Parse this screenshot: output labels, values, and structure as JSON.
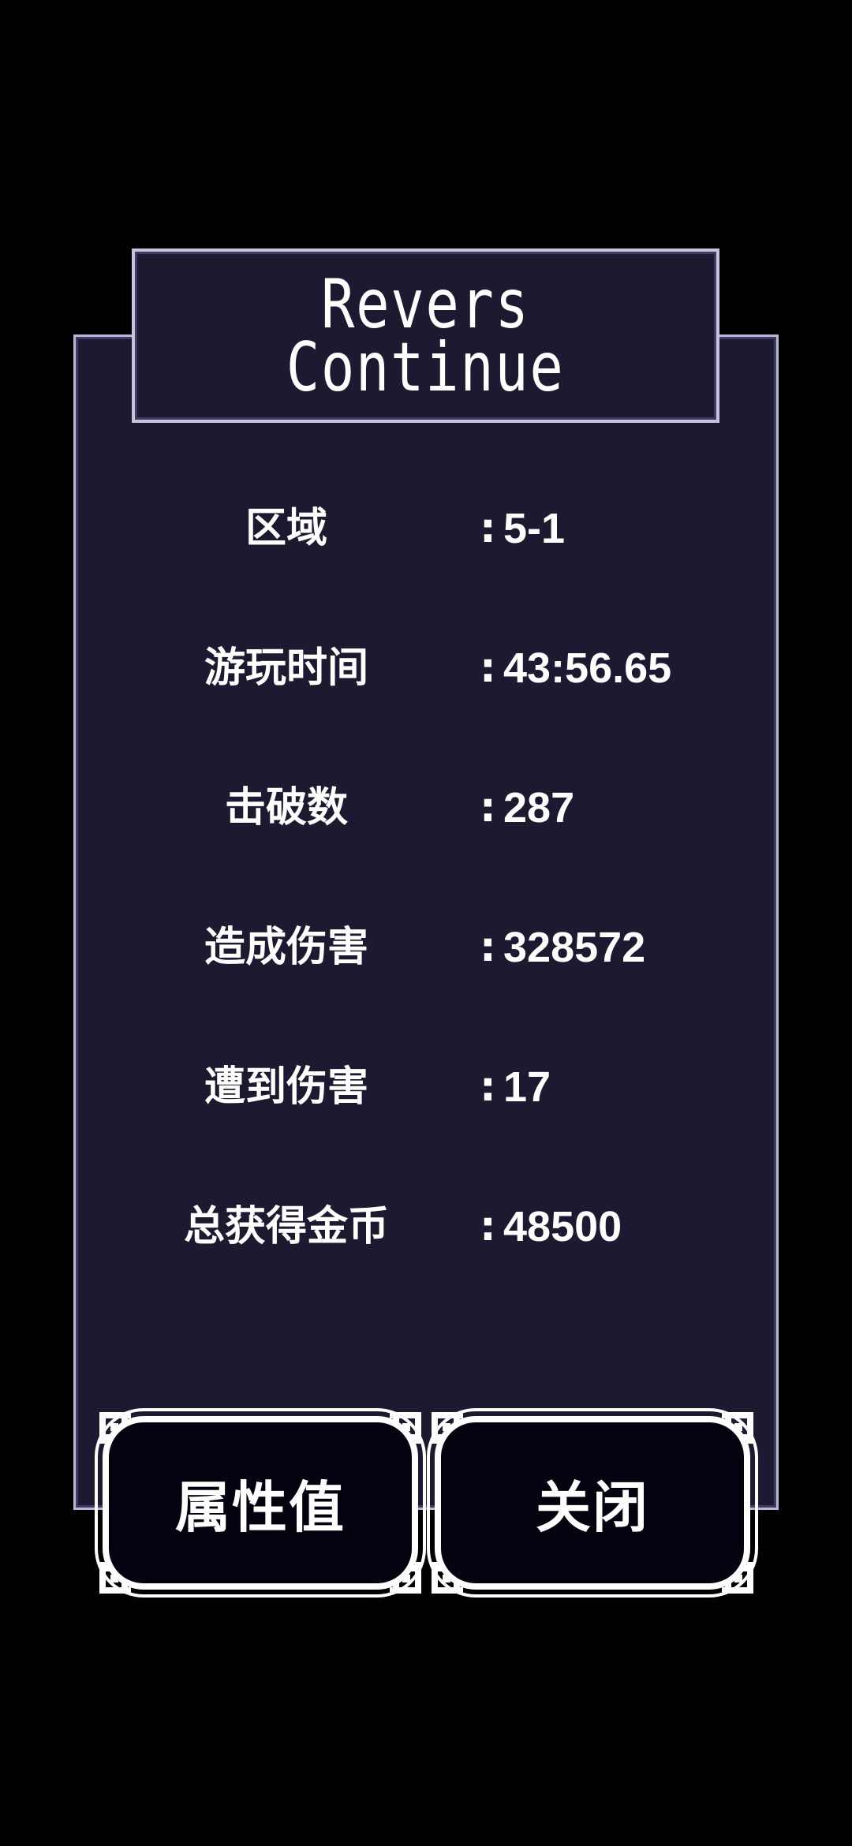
{
  "title": {
    "line1": "Revers",
    "line2": "Continue"
  },
  "stats": [
    {
      "label": "区域",
      "sep": ":",
      "value": "5-1"
    },
    {
      "label": "游玩时间",
      "sep": ":",
      "value": "43:56.65"
    },
    {
      "label": "击破数",
      "sep": ":",
      "value": "287"
    },
    {
      "label": "造成伤害",
      "sep": ":",
      "value": "328572"
    },
    {
      "label": "遭到伤害",
      "sep": ":",
      "value": "17"
    },
    {
      "label": "总获得金币",
      "sep": ":",
      "value": "48500"
    }
  ],
  "buttons": {
    "attributes": "属性值",
    "close": "关闭"
  },
  "colors": {
    "panel": "#1b1a31",
    "border": "#c5c4dc",
    "button_bg": "#03020f",
    "text": "#ffffff"
  }
}
